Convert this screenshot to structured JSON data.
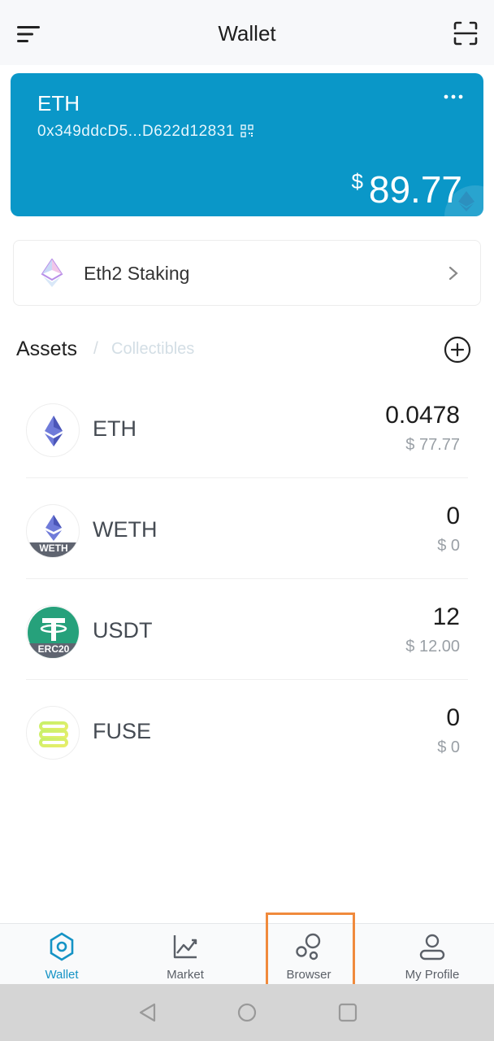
{
  "header": {
    "title": "Wallet",
    "menu_icon": "hamburger-menu-icon",
    "scan_icon": "scan-qr-icon"
  },
  "card": {
    "coin": "ETH",
    "address": "0x349ddcD5...D622d12831",
    "currency_symbol": "$",
    "balance": "89.77",
    "color": "#0a97c8"
  },
  "staking": {
    "label": "Eth2 Staking"
  },
  "tabs": {
    "assets": "Assets",
    "separator": "/",
    "collectibles": "Collectibles"
  },
  "assets": [
    {
      "symbol": "ETH",
      "amount": "0.0478",
      "fiat": "$ 77.77",
      "icon": "eth-icon"
    },
    {
      "symbol": "WETH",
      "amount": "0",
      "fiat": "$ 0",
      "icon": "weth-icon",
      "badge": "WETH"
    },
    {
      "symbol": "USDT",
      "amount": "12",
      "fiat": "$ 12.00",
      "icon": "usdt-icon",
      "badge": "ERC20"
    },
    {
      "symbol": "FUSE",
      "amount": "0",
      "fiat": "$ 0",
      "icon": "fuse-icon"
    }
  ],
  "nav": {
    "items": [
      {
        "label": "Wallet",
        "active": true
      },
      {
        "label": "Market",
        "active": false
      },
      {
        "label": "Browser",
        "active": false
      },
      {
        "label": "My Profile",
        "active": false
      }
    ],
    "active_color": "#1593c5",
    "highlight_color": "#f08a3c"
  }
}
